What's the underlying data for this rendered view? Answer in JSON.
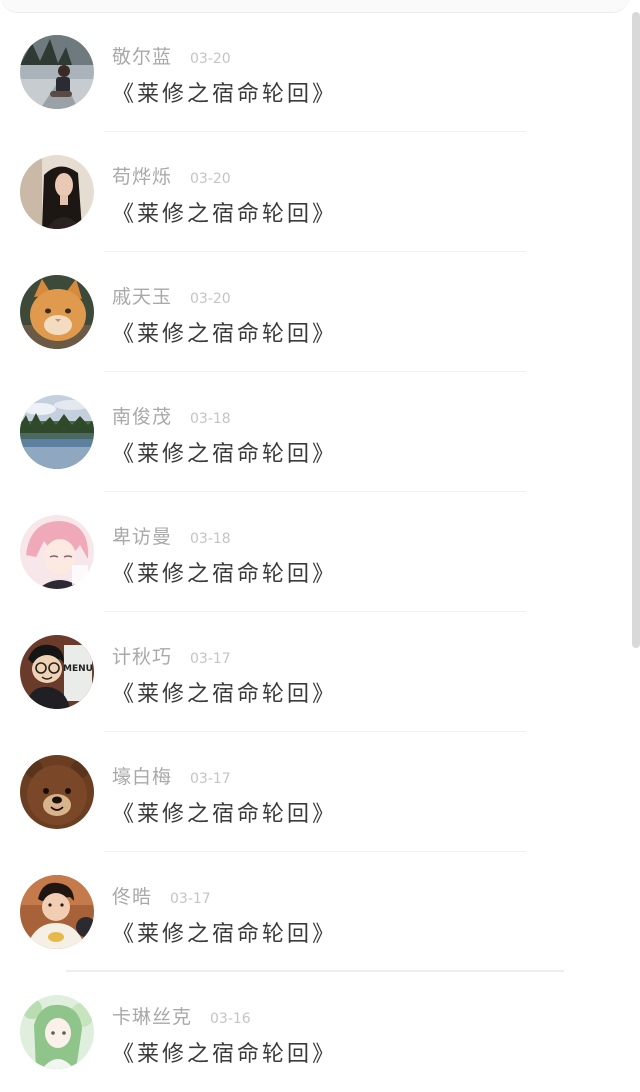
{
  "comments": [
    {
      "name": "敬尔蓝",
      "date": "03-20",
      "text": "《莱修之宿命轮回》",
      "avatar": "avatar-girl-road"
    },
    {
      "name": "苟烨烁",
      "date": "03-20",
      "text": "《莱修之宿命轮回》",
      "avatar": "avatar-woman-portrait"
    },
    {
      "name": "戚天玉",
      "date": "03-20",
      "text": "《莱修之宿命轮回》",
      "avatar": "avatar-orange-cat"
    },
    {
      "name": "南俊茂",
      "date": "03-18",
      "text": "《莱修之宿命轮回》",
      "avatar": "avatar-lake-landscape"
    },
    {
      "name": "卑访曼",
      "date": "03-18",
      "text": "《莱修之宿命轮回》",
      "avatar": "avatar-anime-pink-hair"
    },
    {
      "name": "计秋巧",
      "date": "03-17",
      "text": "《莱修之宿命轮回》",
      "avatar": "avatar-cartoon-menu"
    },
    {
      "name": "壕白梅",
      "date": "03-17",
      "text": "《莱修之宿命轮回》",
      "avatar": "avatar-brown-bear"
    },
    {
      "name": "佟晧",
      "date": "03-17",
      "text": "《莱修之宿命轮回》",
      "avatar": "avatar-boy-photo"
    },
    {
      "name": "卡琳丝克",
      "date": "03-16",
      "text": "《莱修之宿命轮回》",
      "avatar": "avatar-anime-green"
    }
  ],
  "avatar_menu_sign": "MENU",
  "colors": {
    "name": "#a9a9a9",
    "date": "#c4c4c4",
    "text": "#3a3a3a",
    "divider": "#f0f0f0",
    "scrollbar": "#d9d9d9"
  }
}
